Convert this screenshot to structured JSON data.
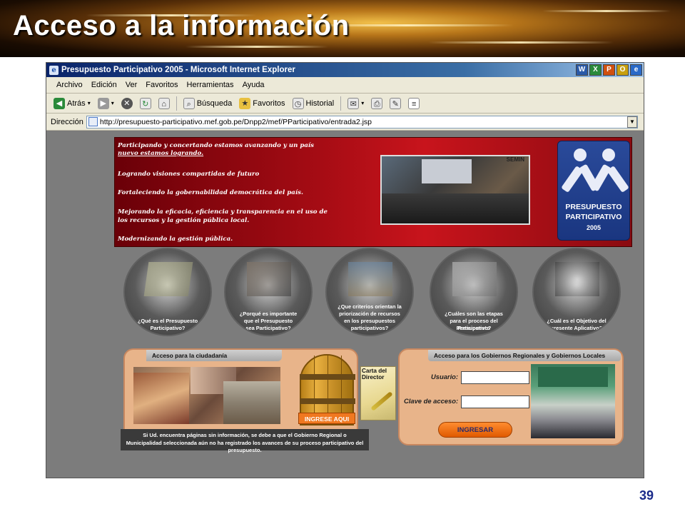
{
  "slide": {
    "title": "Acceso a la información",
    "page_number": "39"
  },
  "browser": {
    "window_title": "Presupuesto Participativo 2005 - Microsoft Internet Explorer",
    "title_icons": [
      "W",
      "X",
      "P",
      "O"
    ],
    "menu": [
      "Archivo",
      "Edición",
      "Ver",
      "Favoritos",
      "Herramientas",
      "Ayuda"
    ],
    "toolbar": {
      "back": "Atrás",
      "search": "Búsqueda",
      "favorites": "Favoritos",
      "history": "Historial"
    },
    "address_label": "Dirección",
    "address_value": "http://presupuesto-participativo.mef.gob.pe/Dnpp2/mef/PParticipativo/entrada2.jsp"
  },
  "hero": {
    "lines": [
      "Participando y concertando estamos avanzando y un país",
      "nuevo estamos logrando.",
      "Logrando visiones compartidas de futuro",
      "Fortaleciendo la gobernabilidad democrática del país.",
      "Mejorando la eficacia, eficiencia y transparencia en el uso de",
      "los recursos y la gestión pública local.",
      "Modernizando la gestión pública."
    ],
    "photo_text": "SEMIN",
    "logo": {
      "line1": "PRESUPUESTO",
      "line2": "PARTICIPATIVO",
      "year": "2005"
    }
  },
  "circles": [
    {
      "lines": [
        "¿Qué es el Presupuesto",
        "Participativo?"
      ]
    },
    {
      "lines": [
        "¿Porqué es importante",
        "que el Presupuesto",
        "sea Participativo?"
      ]
    },
    {
      "lines": [
        "¿Que criterios orientan la",
        "priorización de recursos",
        "en los presupuestos",
        "participativos?"
      ]
    },
    {
      "lines": [
        "¿Cuáles son las etapas",
        "para el proceso del Presupuesto",
        "Participativo?"
      ]
    },
    {
      "lines": [
        "¿Cuál es el Objetivo del",
        "presente Aplicativo?"
      ]
    }
  ],
  "citizen": {
    "tab": "Acceso para la ciudadanía",
    "door_label": "INGRESE AQUI",
    "notice": "Si Ud. encuentra páginas sin información, se debe a que el Gobierno Regional o Municipalidad seleccionada aún no ha registrado los avances de su proceso participativo del presupuesto."
  },
  "letter": {
    "line1": "Carta del",
    "line2": "Director"
  },
  "gov": {
    "tab": "Acceso para los Gobiernos Regionales y Gobiernos Locales",
    "user_label": "Usuario:",
    "user_value": "",
    "pass_label": "Clave de acceso:",
    "pass_value": "",
    "submit": "INGRESAR"
  },
  "colors": {
    "hero_red": "#c8141c",
    "panel_peach": "#e8b48a",
    "button_orange": "#f07820",
    "titlebar_blue": "#0a246a"
  }
}
